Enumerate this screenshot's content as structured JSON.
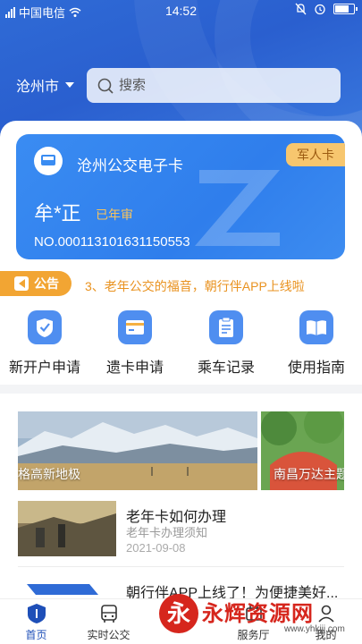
{
  "status": {
    "carrier": "中国电信",
    "time": "14:52"
  },
  "header": {
    "city": "沧州市",
    "search_placeholder": "搜索"
  },
  "card": {
    "title": "沧州公交电子卡",
    "type_tag": "军人卡",
    "holder_name": "牟*正",
    "annual_status": "已年审",
    "card_number": "NO.000113101631150553"
  },
  "notice": {
    "label": "公告",
    "text": "3、老年公交的福音，朝行伴APP上线啦"
  },
  "quick_actions": [
    {
      "label": "新开户申请",
      "icon": "shield-check-icon"
    },
    {
      "label": "遗卡申请",
      "icon": "card-icon"
    },
    {
      "label": "乘车记录",
      "icon": "clipboard-icon"
    },
    {
      "label": "使用指南",
      "icon": "book-icon"
    }
  ],
  "banners": [
    {
      "caption": "格高新地极"
    },
    {
      "caption": "南昌万达主题"
    }
  ],
  "news": [
    {
      "title": "老年卡如何办理",
      "subtitle": "老年卡办理须知",
      "date": "2021-09-08"
    },
    {
      "title": "朝行伴APP上线了！为便捷美好..."
    }
  ],
  "tabs": [
    {
      "label": "首页",
      "icon": "home-shield-icon"
    },
    {
      "label": "实时公交",
      "icon": "bus-icon"
    },
    {
      "label": "服务厅",
      "icon": "service-icon"
    },
    {
      "label": "我的",
      "icon": "user-icon"
    }
  ],
  "watermark": {
    "logo_char": "永",
    "text": "永辉资源网",
    "url": "www.yhkjjj.com"
  },
  "colors": {
    "primary": "#2f6bd6",
    "card": "#3a8cf2",
    "accent": "#f2a533",
    "tab_active": "#1e4fb8"
  }
}
